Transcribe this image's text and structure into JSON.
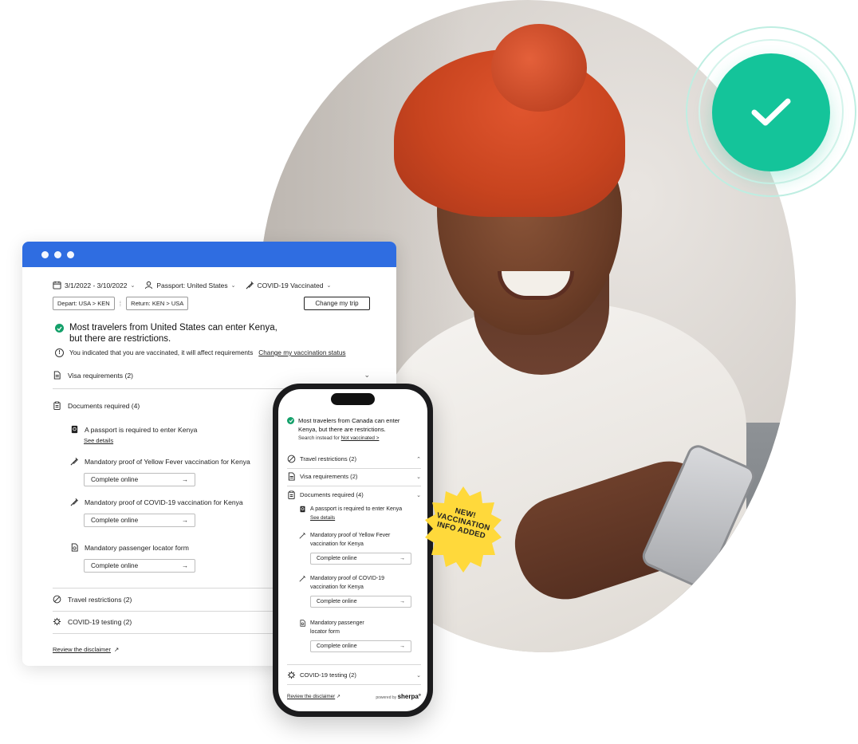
{
  "desktop": {
    "date_range": "3/1/2022 - 3/10/2022",
    "passport": "Passport: United States",
    "vaccination": "COVID-19 Vaccinated",
    "depart": "Depart: USA > KEN",
    "return": "Return: KEN > USA",
    "change_trip": "Change my trip",
    "headline_bold": "Most travelers from United States can enter Kenya,",
    "headline_rest": "but there are restrictions.",
    "vacc_note": "You indicated that you are vaccinated, it will affect requirements",
    "vacc_link": "Change my vaccination status",
    "visa": "Visa requirements (2)",
    "documents": "Documents required (4)",
    "req1": "A passport is required to enter Kenya",
    "see_details": "See details",
    "req2": "Mandatory proof of Yellow Fever vaccination for Kenya",
    "req3": "Mandatory proof of COVID-19 vaccination for Kenya",
    "req4": "Mandatory passenger locator form",
    "complete_online": "Complete online",
    "travel_restrictions": "Travel restrictions (2)",
    "covid_testing": "COVID-19 testing (2)",
    "disclaimer": "Review the disclaimer"
  },
  "phone": {
    "headline_line1": "Most travelers from Canada can enter",
    "headline_line2": "Kenya, but there are restrictions.",
    "search_prefix": "Search instead for",
    "search_link": "Not vaccinated >",
    "travel_restrictions": "Travel restrictions (2)",
    "visa": "Visa requirements (2)",
    "documents": "Documents required (4)",
    "req1": "A passport is required to enter Kenya",
    "see_details": "See details",
    "req2_l1": "Mandatory proof of Yellow Fever",
    "req2_l2": "vaccination for Kenya",
    "req3_l1": "Mandatory proof of COVID-19",
    "req3_l2": "vaccination for Kenya",
    "req4_l1": "Mandatory passenger",
    "req4_l2": "locator form",
    "complete_online": "Complete online",
    "covid_testing": "COVID-19 testing (2)",
    "disclaimer": "Review the disclaimer",
    "powered_by": "powered by",
    "brand": "sherpa°"
  },
  "sticker": {
    "line1": "NEW!",
    "line2": "VACCINATION",
    "line3": "INFO ADDED"
  },
  "colors": {
    "browser_bar": "#2f6de1",
    "success_badge": "#14c49a",
    "sticker": "#ffd93b"
  }
}
